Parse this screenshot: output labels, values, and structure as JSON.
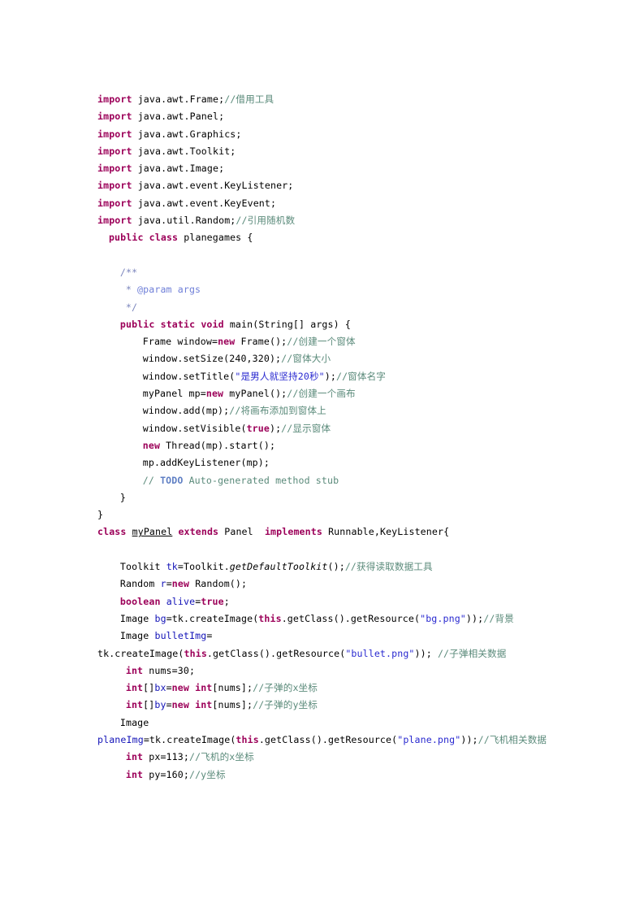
{
  "document": {
    "language": "java",
    "class_name": "planegames",
    "page_background": "#ffffff",
    "colors": {
      "keyword": "#9c0059",
      "string": "#2a2ad0",
      "comment": "#5a8a7a",
      "javadoc": "#7b85bd",
      "javadoc_tag": "#6f7fd8",
      "todo_tag": "#5f7fc4",
      "field": "#1414b8",
      "plain": "#000000"
    }
  },
  "code": {
    "lines": [
      {
        "id": "l01",
        "indent": 0,
        "tokens": [
          {
            "t": "kw",
            "v": "import"
          },
          {
            "t": "plain",
            "v": " java.awt.Frame;"
          },
          {
            "t": "cmt",
            "v": "//借用工具"
          }
        ]
      },
      {
        "id": "l02",
        "indent": 0,
        "tokens": [
          {
            "t": "kw",
            "v": "import"
          },
          {
            "t": "plain",
            "v": " java.awt.Panel;"
          }
        ]
      },
      {
        "id": "l03",
        "indent": 0,
        "tokens": [
          {
            "t": "kw",
            "v": "import"
          },
          {
            "t": "plain",
            "v": " java.awt.Graphics;"
          }
        ]
      },
      {
        "id": "l04",
        "indent": 0,
        "tokens": [
          {
            "t": "kw",
            "v": "import"
          },
          {
            "t": "plain",
            "v": " java.awt.Toolkit;"
          }
        ]
      },
      {
        "id": "l05",
        "indent": 0,
        "tokens": [
          {
            "t": "kw",
            "v": "import"
          },
          {
            "t": "plain",
            "v": " java.awt.Image;"
          }
        ]
      },
      {
        "id": "l06",
        "indent": 0,
        "tokens": [
          {
            "t": "kw",
            "v": "import"
          },
          {
            "t": "plain",
            "v": " java.awt.event.KeyListener;"
          }
        ]
      },
      {
        "id": "l07",
        "indent": 0,
        "tokens": [
          {
            "t": "kw",
            "v": "import"
          },
          {
            "t": "plain",
            "v": " java.awt.event.KeyEvent;"
          }
        ]
      },
      {
        "id": "l08",
        "indent": 0,
        "tokens": [
          {
            "t": "kw",
            "v": "import"
          },
          {
            "t": "plain",
            "v": " java.util.Random;"
          },
          {
            "t": "cmt",
            "v": "//引用随机数"
          }
        ]
      },
      {
        "id": "l09",
        "indent": 2,
        "tokens": [
          {
            "t": "kw",
            "v": "public"
          },
          {
            "t": "plain",
            "v": " "
          },
          {
            "t": "kw",
            "v": "class"
          },
          {
            "t": "plain",
            "v": " planegames {"
          }
        ]
      },
      {
        "id": "l10",
        "indent": 0,
        "tokens": [
          {
            "t": "plain",
            "v": ""
          }
        ]
      },
      {
        "id": "l11",
        "indent": 4,
        "tokens": [
          {
            "t": "doc",
            "v": "/**"
          }
        ]
      },
      {
        "id": "l12",
        "indent": 5,
        "tokens": [
          {
            "t": "doc",
            "v": "* "
          },
          {
            "t": "tag",
            "v": "@param"
          },
          {
            "t": "tag",
            "v": " args"
          }
        ]
      },
      {
        "id": "l13",
        "indent": 5,
        "tokens": [
          {
            "t": "doc",
            "v": "*/"
          }
        ]
      },
      {
        "id": "l14",
        "indent": 4,
        "tokens": [
          {
            "t": "kw",
            "v": "public"
          },
          {
            "t": "plain",
            "v": " "
          },
          {
            "t": "kw",
            "v": "static"
          },
          {
            "t": "plain",
            "v": " "
          },
          {
            "t": "kw",
            "v": "void"
          },
          {
            "t": "plain",
            "v": " main(String[] args) {"
          }
        ]
      },
      {
        "id": "l15",
        "indent": 8,
        "tokens": [
          {
            "t": "plain",
            "v": "Frame window="
          },
          {
            "t": "kw",
            "v": "new"
          },
          {
            "t": "plain",
            "v": " Frame();"
          },
          {
            "t": "cmt",
            "v": "//创建一个窗体"
          }
        ]
      },
      {
        "id": "l16",
        "indent": 8,
        "tokens": [
          {
            "t": "plain",
            "v": "window.setSize(240,320);"
          },
          {
            "t": "cmt",
            "v": "//窗体大小"
          }
        ]
      },
      {
        "id": "l17",
        "indent": 8,
        "tokens": [
          {
            "t": "plain",
            "v": "window.setTitle("
          },
          {
            "t": "str",
            "v": "\"是男人就坚持20秒\""
          },
          {
            "t": "plain",
            "v": ");"
          },
          {
            "t": "cmt",
            "v": "//窗体名字"
          }
        ]
      },
      {
        "id": "l18",
        "indent": 8,
        "tokens": [
          {
            "t": "plain",
            "v": "myPanel mp="
          },
          {
            "t": "kw",
            "v": "new"
          },
          {
            "t": "plain",
            "v": " myPanel();"
          },
          {
            "t": "cmt",
            "v": "//创建一个画布"
          }
        ]
      },
      {
        "id": "l19",
        "indent": 8,
        "tokens": [
          {
            "t": "plain",
            "v": "window.add(mp);"
          },
          {
            "t": "cmt",
            "v": "//将画布添加到窗体上"
          }
        ]
      },
      {
        "id": "l20",
        "indent": 8,
        "tokens": [
          {
            "t": "plain",
            "v": "window.setVisible("
          },
          {
            "t": "kw",
            "v": "true"
          },
          {
            "t": "plain",
            "v": ");"
          },
          {
            "t": "cmt",
            "v": "//显示窗体"
          }
        ]
      },
      {
        "id": "l21",
        "indent": 8,
        "tokens": [
          {
            "t": "kw",
            "v": "new"
          },
          {
            "t": "plain",
            "v": " Thread(mp).start();"
          }
        ]
      },
      {
        "id": "l22",
        "indent": 8,
        "tokens": [
          {
            "t": "plain",
            "v": "mp.addKeyListener(mp);"
          }
        ]
      },
      {
        "id": "l23",
        "indent": 8,
        "tokens": [
          {
            "t": "cmt",
            "v": "// "
          },
          {
            "t": "todo",
            "v": "TODO"
          },
          {
            "t": "cmt",
            "v": " Auto-generated method stub"
          }
        ]
      },
      {
        "id": "l24",
        "indent": 4,
        "tokens": [
          {
            "t": "plain",
            "v": "}"
          }
        ]
      },
      {
        "id": "l25",
        "indent": 0,
        "tokens": [
          {
            "t": "plain",
            "v": "}"
          }
        ]
      },
      {
        "id": "l26",
        "indent": 0,
        "tokens": [
          {
            "t": "kw",
            "v": "class"
          },
          {
            "t": "plain",
            "v": " "
          },
          {
            "t": "uline",
            "v": "myPanel"
          },
          {
            "t": "plain",
            "v": " "
          },
          {
            "t": "kw",
            "v": "extends"
          },
          {
            "t": "plain",
            "v": " Panel  "
          },
          {
            "t": "kw",
            "v": "implements"
          },
          {
            "t": "plain",
            "v": " Runnable,KeyListener{"
          }
        ]
      },
      {
        "id": "l27",
        "indent": 0,
        "tokens": [
          {
            "t": "plain",
            "v": ""
          }
        ]
      },
      {
        "id": "l28",
        "indent": 4,
        "tokens": [
          {
            "t": "plain",
            "v": "Toolkit "
          },
          {
            "t": "fld",
            "v": "tk"
          },
          {
            "t": "plain",
            "v": "=Toolkit."
          },
          {
            "t": "ital",
            "v": "getDefaultToolkit"
          },
          {
            "t": "plain",
            "v": "();"
          },
          {
            "t": "cmt",
            "v": "//获得读取数据工具"
          }
        ]
      },
      {
        "id": "l29",
        "indent": 4,
        "tokens": [
          {
            "t": "plain",
            "v": "Random "
          },
          {
            "t": "fld",
            "v": "r"
          },
          {
            "t": "plain",
            "v": "="
          },
          {
            "t": "kw",
            "v": "new"
          },
          {
            "t": "plain",
            "v": " Random();"
          }
        ]
      },
      {
        "id": "l30",
        "indent": 4,
        "tokens": [
          {
            "t": "kw",
            "v": "boolean"
          },
          {
            "t": "plain",
            "v": " "
          },
          {
            "t": "fld",
            "v": "alive"
          },
          {
            "t": "plain",
            "v": "="
          },
          {
            "t": "kw",
            "v": "true"
          },
          {
            "t": "plain",
            "v": ";"
          }
        ]
      },
      {
        "id": "l31",
        "indent": 4,
        "tokens": [
          {
            "t": "plain",
            "v": "Image "
          },
          {
            "t": "fld",
            "v": "bg"
          },
          {
            "t": "plain",
            "v": "=tk.createImage("
          },
          {
            "t": "kw",
            "v": "this"
          },
          {
            "t": "plain",
            "v": ".getClass().getResource("
          },
          {
            "t": "str",
            "v": "\"bg.png\""
          },
          {
            "t": "plain",
            "v": "));"
          },
          {
            "t": "cmt",
            "v": "//背景"
          }
        ]
      },
      {
        "id": "l32",
        "indent": 4,
        "tokens": [
          {
            "t": "plain",
            "v": "Image "
          },
          {
            "t": "fld",
            "v": "bulletImg"
          },
          {
            "t": "plain",
            "v": "="
          }
        ]
      },
      {
        "id": "l33",
        "indent": 0,
        "tokens": [
          {
            "t": "plain",
            "v": "tk.createImage("
          },
          {
            "t": "kw",
            "v": "this"
          },
          {
            "t": "plain",
            "v": ".getClass().getResource("
          },
          {
            "t": "str",
            "v": "\"bullet.png\""
          },
          {
            "t": "plain",
            "v": ")); "
          },
          {
            "t": "cmt",
            "v": "//子弹相关数据"
          }
        ]
      },
      {
        "id": "l34",
        "indent": 5,
        "tokens": [
          {
            "t": "kw",
            "v": "int"
          },
          {
            "t": "plain",
            "v": " nums=30;"
          }
        ]
      },
      {
        "id": "l35",
        "indent": 5,
        "tokens": [
          {
            "t": "kw",
            "v": "int"
          },
          {
            "t": "plain",
            "v": "[]"
          },
          {
            "t": "fld",
            "v": "bx"
          },
          {
            "t": "plain",
            "v": "="
          },
          {
            "t": "kw",
            "v": "new"
          },
          {
            "t": "plain",
            "v": " "
          },
          {
            "t": "kw",
            "v": "int"
          },
          {
            "t": "plain",
            "v": "[nums];"
          },
          {
            "t": "cmt",
            "v": "//子弹的x坐标"
          }
        ]
      },
      {
        "id": "l36",
        "indent": 5,
        "tokens": [
          {
            "t": "kw",
            "v": "int"
          },
          {
            "t": "plain",
            "v": "[]"
          },
          {
            "t": "fld",
            "v": "by"
          },
          {
            "t": "plain",
            "v": "="
          },
          {
            "t": "kw",
            "v": "new"
          },
          {
            "t": "plain",
            "v": " "
          },
          {
            "t": "kw",
            "v": "int"
          },
          {
            "t": "plain",
            "v": "[nums];"
          },
          {
            "t": "cmt",
            "v": "//子弹的y坐标"
          }
        ]
      },
      {
        "id": "l37",
        "indent": 4,
        "tokens": [
          {
            "t": "plain",
            "v": "Image"
          }
        ]
      },
      {
        "id": "l38",
        "indent": 0,
        "tokens": [
          {
            "t": "fld",
            "v": "planeImg"
          },
          {
            "t": "plain",
            "v": "=tk.createImage("
          },
          {
            "t": "kw",
            "v": "this"
          },
          {
            "t": "plain",
            "v": ".getClass().getResource("
          },
          {
            "t": "str",
            "v": "\"plane.png\""
          },
          {
            "t": "plain",
            "v": "));"
          },
          {
            "t": "cmt",
            "v": "//飞机相关数据"
          }
        ]
      },
      {
        "id": "l39",
        "indent": 5,
        "tokens": [
          {
            "t": "kw",
            "v": "int"
          },
          {
            "t": "plain",
            "v": " px=113;"
          },
          {
            "t": "cmt",
            "v": "//飞机的x坐标"
          }
        ]
      },
      {
        "id": "l40",
        "indent": 5,
        "tokens": [
          {
            "t": "kw",
            "v": "int"
          },
          {
            "t": "plain",
            "v": " py=160;"
          },
          {
            "t": "cmt",
            "v": "//y坐标"
          }
        ]
      }
    ]
  }
}
